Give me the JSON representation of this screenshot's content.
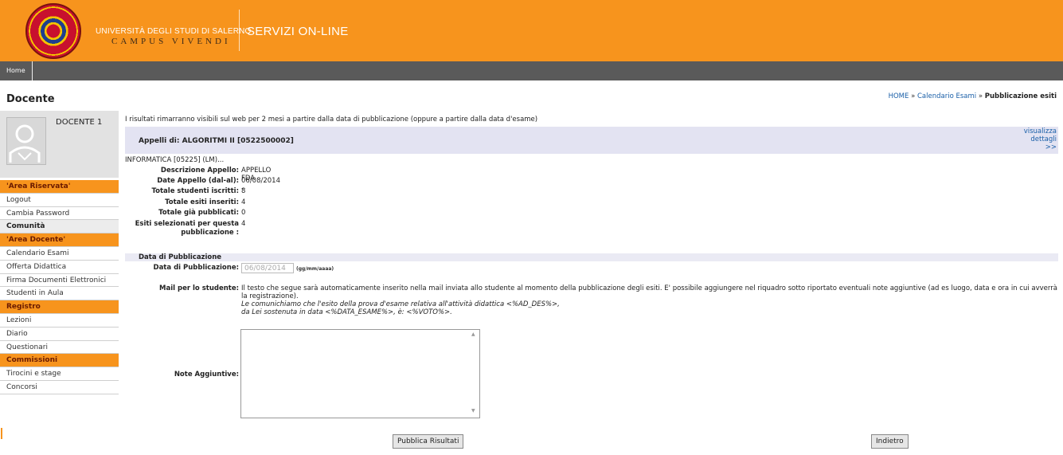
{
  "header": {
    "university_line1": "UNIVERSITÀ DEGLI STUDI DI SALERNO",
    "university_line2": "CAMPUS VIVENDI",
    "service_title": "SERVIZI ON-LINE",
    "brand_color": "#f7941d"
  },
  "navbar": {
    "home_label": "Home"
  },
  "sidebar": {
    "title": "Docente",
    "profile_name": "DOCENTE 1",
    "items": [
      {
        "label": "'Area Riservata'",
        "kind": "head-orange"
      },
      {
        "label": "Logout",
        "kind": "item"
      },
      {
        "label": "Cambia Password",
        "kind": "item"
      },
      {
        "label": "Comunità",
        "kind": "head-gray"
      },
      {
        "label": "'Area Docente'",
        "kind": "head-orange"
      },
      {
        "label": "Calendario Esami",
        "kind": "item"
      },
      {
        "label": "Offerta Didattica",
        "kind": "item"
      },
      {
        "label": "Firma Documenti Elettronici",
        "kind": "item"
      },
      {
        "label": "Studenti in Aula",
        "kind": "item"
      },
      {
        "label": "Registro",
        "kind": "head-orange"
      },
      {
        "label": "Lezioni",
        "kind": "item"
      },
      {
        "label": "Diario",
        "kind": "item"
      },
      {
        "label": "Questionari",
        "kind": "item"
      },
      {
        "label": "Commissioni",
        "kind": "head-orange"
      },
      {
        "label": "Tirocini e stage",
        "kind": "item"
      },
      {
        "label": "Concorsi",
        "kind": "item"
      }
    ]
  },
  "breadcrumb": {
    "home": "HOME",
    "sep": "»",
    "calendar": "Calendario Esami",
    "current": "Pubblicazione esiti"
  },
  "notice": "I risultati rimarranno visibili sul web per 2 mesi a partire dalla data di pubblicazione (oppure a partire dalla data d'esame)",
  "appelli": {
    "title": "Appelli di: ALGORITMI II [0522500002]",
    "details_line1": "visualizza",
    "details_line2": "dettagli",
    "details_line3": ">>"
  },
  "course_line": "INFORMATICA [05225] (LM)...",
  "info": {
    "descrizione_label": "Descrizione Appello:",
    "descrizione_value": "APPELLO FDA",
    "date_label": "Date Appello (dal-al):",
    "date_value": "06/08/2014 -",
    "iscritti_label": "Totale studenti iscritti:",
    "iscritti_value": "8",
    "inseriti_label": "Totale esiti inseriti:",
    "inseriti_value": "4",
    "pubblicati_label": "Totale già pubblicati:",
    "pubblicati_value": "0",
    "selezionati_label_1": "Esiti selezionati per questa",
    "selezionati_label_2": "pubblicazione :",
    "selezionati_value": "4"
  },
  "publication": {
    "section_title": "Data di Pubblicazione",
    "date_label": "Data di Pubblicazione:",
    "date_value": "06/08/2014",
    "date_hint": "(gg/mm/aaaa)",
    "mail_label": "Mail per lo studente:",
    "mail_text_1": "Il testo che segue sarà automaticamente inserito nella mail inviata allo studente al momento della pubblicazione degli esiti. E' possibile aggiungere nel riquadro sotto riportato eventuali note aggiuntive (ad es luogo, data e ora in cui avverrà la registrazione).",
    "mail_text_2": "Le comunichiamo che l'esito della prova d'esame relativa all'attività didattica <%AD_DES%>,",
    "mail_text_3": "da Lei sostenuta in data <%DATA_ESAME%>, è: <%VOTO%>.",
    "notes_label": "Note Aggiuntive:",
    "notes_value": ""
  },
  "buttons": {
    "publish": "Pubblica Risultati",
    "back": "Indietro"
  }
}
